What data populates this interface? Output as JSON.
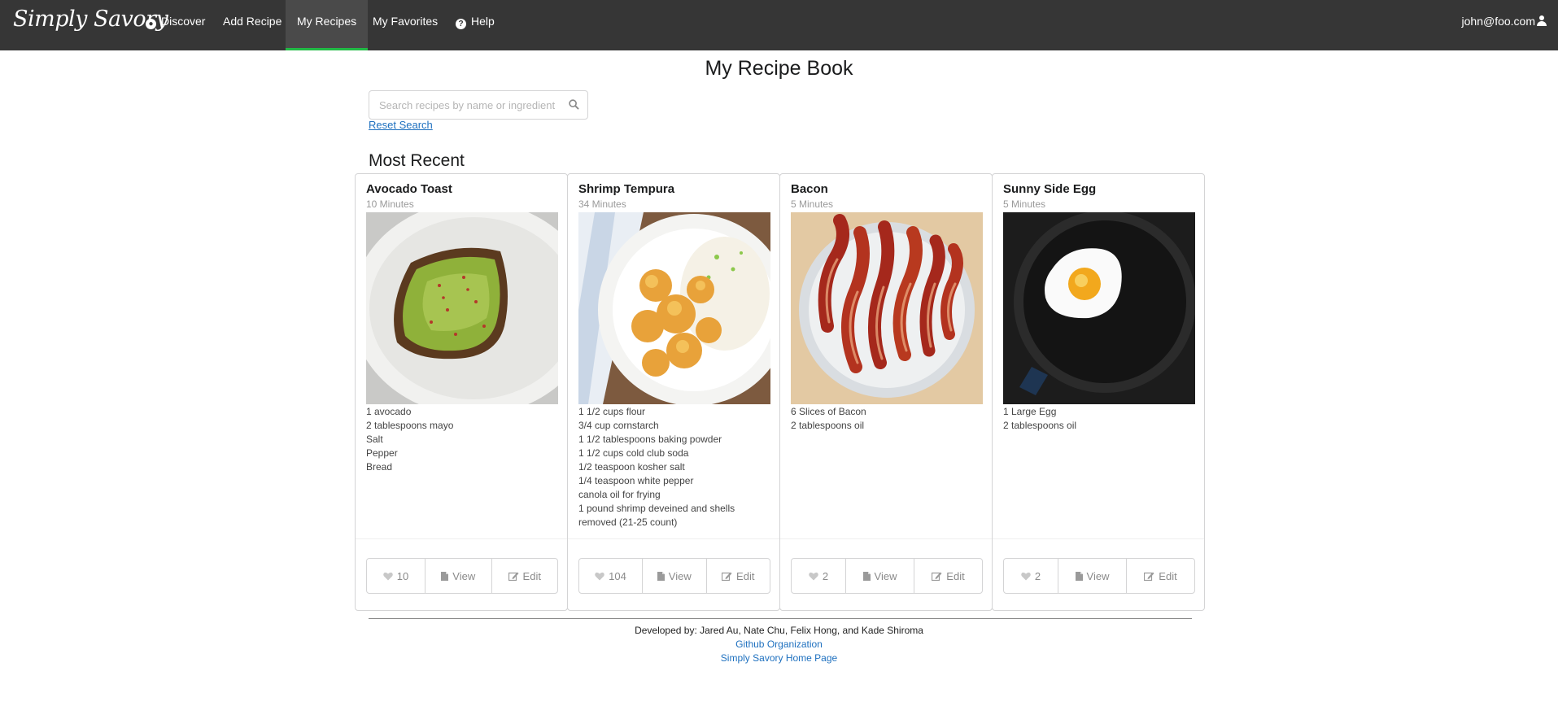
{
  "nav": {
    "brand": "Simply Savory",
    "items": [
      {
        "label": "Discover",
        "icon": "compass-icon"
      },
      {
        "label": "Add Recipe"
      },
      {
        "label": "My Recipes",
        "active": true
      },
      {
        "label": "My Favorites"
      },
      {
        "label": "Help",
        "icon": "help-icon"
      }
    ],
    "user": "john@foo.com"
  },
  "page": {
    "title": "My Recipe Book",
    "search_placeholder": "Search recipes by name or ingredient",
    "reset_label": "Reset Search",
    "section_title": "Most Recent"
  },
  "recipes": [
    {
      "title": "Avocado Toast",
      "time": "10 Minutes",
      "ingredients": [
        "1 avocado",
        "2 tablespoons mayo",
        "Salt",
        "Pepper",
        "Bread"
      ],
      "likes": "10",
      "view_label": "View",
      "edit_label": "Edit"
    },
    {
      "title": "Shrimp Tempura",
      "time": "34 Minutes",
      "ingredients": [
        "1 1/2 cups flour",
        "3/4 cup cornstarch",
        "1 1/2 tablespoons baking powder",
        "1 1/2 cups cold club soda",
        "1/2 teaspoon kosher salt",
        "1/4 teaspoon white pepper",
        "canola oil for frying",
        "1 pound shrimp deveined and shells removed (21-25 count)"
      ],
      "likes": "104",
      "view_label": "View",
      "edit_label": "Edit"
    },
    {
      "title": "Bacon",
      "time": "5 Minutes",
      "ingredients": [
        "6 Slices of Bacon",
        "2 tablespoons oil"
      ],
      "likes": "2",
      "view_label": "View",
      "edit_label": "Edit"
    },
    {
      "title": "Sunny Side Egg",
      "time": "5 Minutes",
      "ingredients": [
        "1 Large Egg",
        "2 tablespoons oil"
      ],
      "likes": "2",
      "view_label": "View",
      "edit_label": "Edit"
    }
  ],
  "footer": {
    "credit": "Developed by: Jared Au, Nate Chu, Felix Hong, and Kade Shiroma",
    "github_label": "Github Organization",
    "home_label": "Simply Savory Home Page"
  },
  "colors": {
    "navbar": "#363636",
    "active_underline": "#21ba45",
    "link": "#1e70bf"
  }
}
